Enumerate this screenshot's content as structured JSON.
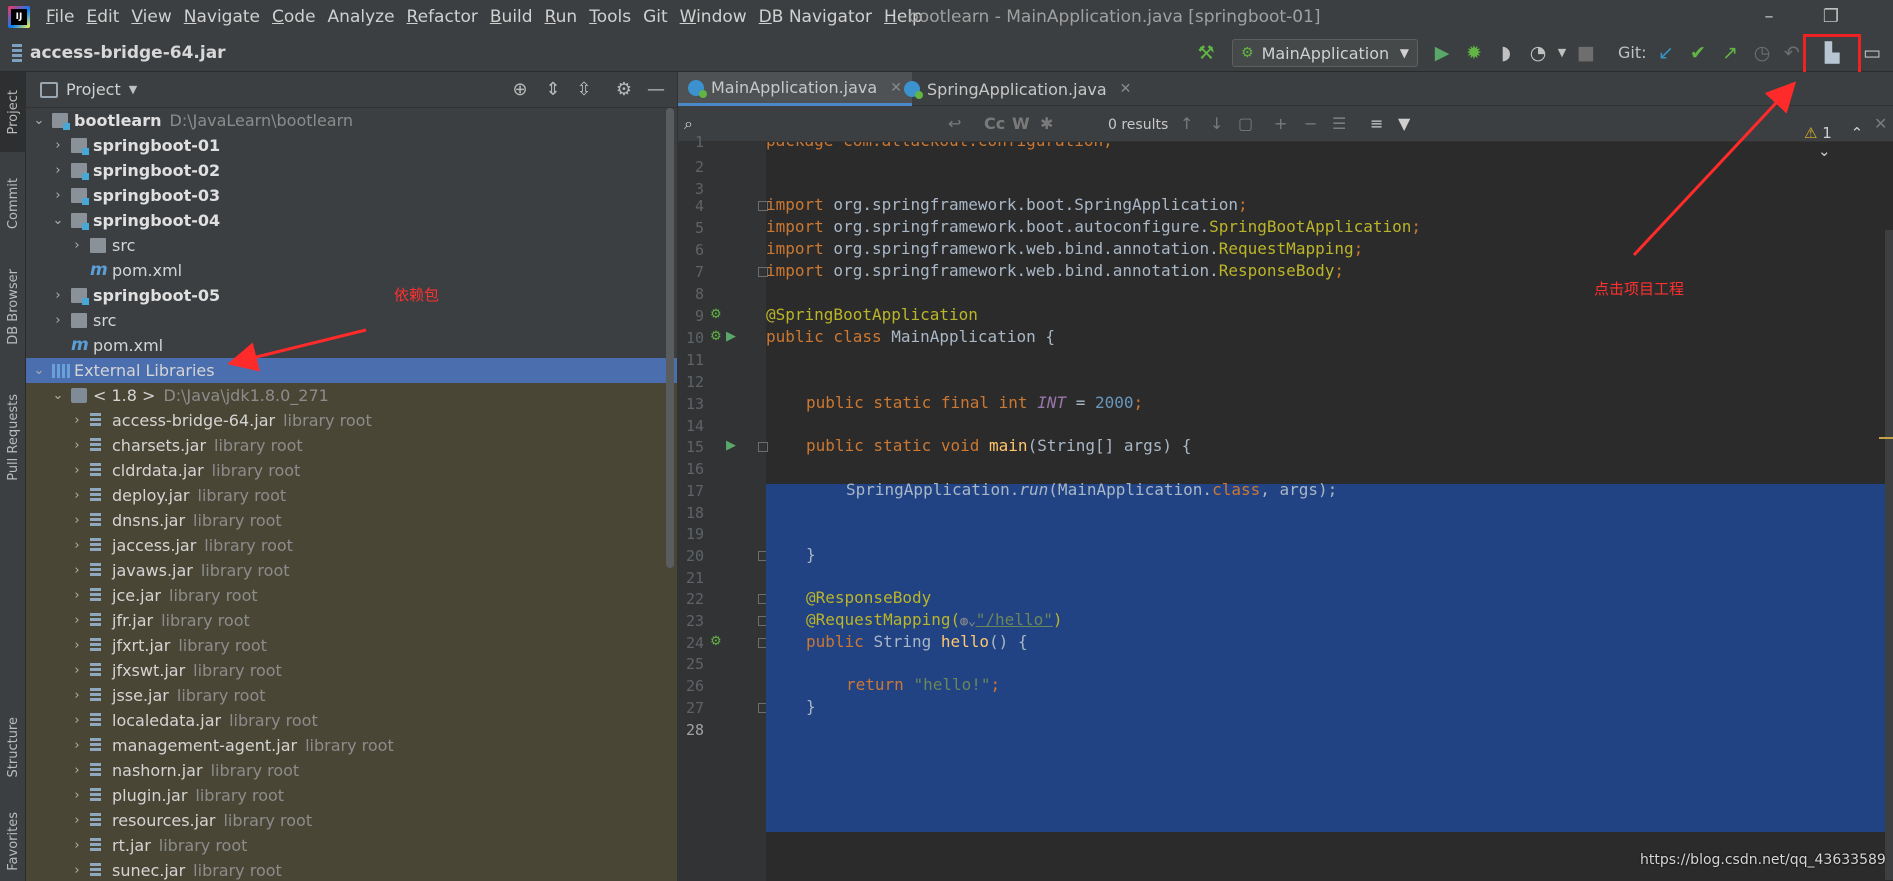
{
  "menu": [
    {
      "label": "File",
      "mn": "F",
      "rest": "ile"
    },
    {
      "label": "Edit",
      "mn": "E",
      "rest": "dit"
    },
    {
      "label": "View",
      "mn": "V",
      "rest": "iew"
    },
    {
      "label": "Navigate",
      "mn": "N",
      "rest": "avigate"
    },
    {
      "label": "Code",
      "mn": "C",
      "rest": "ode"
    },
    {
      "label": "Analyze",
      "mn": "",
      "rest": "Analyze"
    },
    {
      "label": "Refactor",
      "mn": "R",
      "rest": "efactor"
    },
    {
      "label": "Build",
      "mn": "B",
      "rest": "uild"
    },
    {
      "label": "Run",
      "mn": "R",
      "rest": "un"
    },
    {
      "label": "Tools",
      "mn": "T",
      "rest": "ools"
    },
    {
      "label": "Git",
      "mn": "",
      "rest": "Git"
    },
    {
      "label": "Window",
      "mn": "W",
      "rest": "indow"
    },
    {
      "label": "DB Navigator",
      "mn": "D",
      "rest": "B Navigator"
    },
    {
      "label": "Help",
      "mn": "H",
      "rest": "elp"
    }
  ],
  "window_title": "bootlearn - MainApplication.java [springboot-01]",
  "nav": {
    "file": "access-bridge-64.jar",
    "run_config": "MainApplication",
    "git_label": "Git:"
  },
  "left_tabs": {
    "project": "Project",
    "commit": "Commit",
    "db_browser": "DB Browser",
    "pull_requests": "Pull Requests",
    "structure": "Structure",
    "favorites": "Favorites"
  },
  "project_panel": {
    "title": "Project",
    "tree": [
      {
        "label": "bootlearn",
        "hint": "D:\\JavaLearn\\bootlearn",
        "bold": true,
        "icon": "module-folder",
        "arrow": "down"
      },
      {
        "label": "springboot-01",
        "hint": "",
        "bold": true,
        "icon": "module-folder",
        "arrow": "right"
      },
      {
        "label": "springboot-02",
        "hint": "",
        "bold": true,
        "icon": "module-folder",
        "arrow": "right"
      },
      {
        "label": "springboot-03",
        "hint": "",
        "bold": true,
        "icon": "module-folder",
        "arrow": "right"
      },
      {
        "label": "springboot-04",
        "hint": "",
        "bold": true,
        "icon": "module-folder",
        "arrow": "down"
      },
      {
        "label": "src",
        "hint": "",
        "bold": false,
        "icon": "folder",
        "arrow": "right"
      },
      {
        "label": "pom.xml",
        "hint": "",
        "bold": false,
        "icon": "maven",
        "arrow": ""
      },
      {
        "label": "springboot-05",
        "hint": "",
        "bold": true,
        "icon": "module-folder",
        "arrow": "right"
      },
      {
        "label": "src",
        "hint": "",
        "bold": false,
        "icon": "folder",
        "arrow": "right"
      },
      {
        "label": "pom.xml",
        "hint": "",
        "bold": false,
        "icon": "maven",
        "arrow": ""
      },
      {
        "label": "External Libraries",
        "hint": "",
        "bold": false,
        "icon": "libraries",
        "arrow": "down",
        "selected": true
      },
      {
        "label": "< 1.8 >",
        "hint": "D:\\Java\\jdk1.8.0_271",
        "bold": false,
        "icon": "jdk",
        "arrow": "down",
        "lib": true
      },
      {
        "label": "access-bridge-64.jar",
        "hint": "library root",
        "icon": "jar",
        "arrow": "right",
        "lib": true
      },
      {
        "label": "charsets.jar",
        "hint": "library root",
        "icon": "jar",
        "arrow": "right",
        "lib": true
      },
      {
        "label": "cldrdata.jar",
        "hint": "library root",
        "icon": "jar",
        "arrow": "right",
        "lib": true
      },
      {
        "label": "deploy.jar",
        "hint": "library root",
        "icon": "jar",
        "arrow": "right",
        "lib": true
      },
      {
        "label": "dnsns.jar",
        "hint": "library root",
        "icon": "jar",
        "arrow": "right",
        "lib": true
      },
      {
        "label": "jaccess.jar",
        "hint": "library root",
        "icon": "jar",
        "arrow": "right",
        "lib": true
      },
      {
        "label": "javaws.jar",
        "hint": "library root",
        "icon": "jar",
        "arrow": "right",
        "lib": true
      },
      {
        "label": "jce.jar",
        "hint": "library root",
        "icon": "jar",
        "arrow": "right",
        "lib": true
      },
      {
        "label": "jfr.jar",
        "hint": "library root",
        "icon": "jar",
        "arrow": "right",
        "lib": true
      },
      {
        "label": "jfxrt.jar",
        "hint": "library root",
        "icon": "jar",
        "arrow": "right",
        "lib": true
      },
      {
        "label": "jfxswt.jar",
        "hint": "library root",
        "icon": "jar",
        "arrow": "right",
        "lib": true
      },
      {
        "label": "jsse.jar",
        "hint": "library root",
        "icon": "jar",
        "arrow": "right",
        "lib": true
      },
      {
        "label": "localedata.jar",
        "hint": "library root",
        "icon": "jar",
        "arrow": "right",
        "lib": true
      },
      {
        "label": "management-agent.jar",
        "hint": "library root",
        "icon": "jar",
        "arrow": "right",
        "lib": true
      },
      {
        "label": "nashorn.jar",
        "hint": "library root",
        "icon": "jar",
        "arrow": "right",
        "lib": true
      },
      {
        "label": "plugin.jar",
        "hint": "library root",
        "icon": "jar",
        "arrow": "right",
        "lib": true
      },
      {
        "label": "resources.jar",
        "hint": "library root",
        "icon": "jar",
        "arrow": "right",
        "lib": true
      },
      {
        "label": "rt.jar",
        "hint": "library root",
        "icon": "jar",
        "arrow": "right",
        "lib": true
      },
      {
        "label": "sunec.jar",
        "hint": "library root",
        "icon": "jar",
        "arrow": "right",
        "lib": true
      }
    ]
  },
  "editor": {
    "tabs": [
      {
        "label": "MainApplication.java",
        "active": true
      },
      {
        "label": "SpringApplication.java",
        "active": false
      }
    ],
    "find": {
      "results": "0 results",
      "cc": "Cc",
      "w": "W"
    },
    "warnings": "1",
    "line_numbers": [
      "1",
      "2",
      "3",
      "4",
      "5",
      "6",
      "7",
      "8",
      "9",
      "10",
      "11",
      "12",
      "13",
      "14",
      "15",
      "16",
      "17",
      "18",
      "19",
      "20",
      "21",
      "22",
      "23",
      "24",
      "25",
      "26",
      "27",
      "28"
    ],
    "code": {
      "l1": "package com.atlackout.configuration;",
      "l4a": "import org.springframework.boot.SpringApplication;",
      "l5a": "import org.springframework.boot.autoconfigure.",
      "l5b": "SpringBootApplication",
      "l6a": "import org.springframework.web.bind.annotation.",
      "l6b": "RequestMapping",
      "l7a": "import org.springframework.web.bind.annotation.",
      "l7b": "ResponseBody",
      "l9": "@SpringBootApplication",
      "l10a": "public class",
      "l10b": " MainApplication {",
      "l13a": "public static final int ",
      "l13b": "INT",
      "l13c": " = ",
      "l13d": "2000",
      "l15a": "public static void ",
      "l15b": "main",
      "l15c": "(String[] args) {",
      "l17a": "SpringApplication.",
      "l17b": "run",
      "l17c": "(MainApplication.",
      "l17d": "class",
      "l17e": ", args);",
      "l20": "}",
      "l22": "@ResponseBody",
      "l23a": "@RequestMapping(",
      "l23b": "\"/hello\"",
      "l23c": ")",
      "l24a": "public ",
      "l24b": "String ",
      "l24c": "hello",
      "l24d": "() {",
      "l26a": "return ",
      "l26b": "\"hello!\"",
      "l26c": ";",
      "l27": "}"
    }
  },
  "annotations": {
    "dependency": "依赖包",
    "click_project": "点击项目工程",
    "watermark": "https://blog.csdn.net/qq_43633589"
  }
}
